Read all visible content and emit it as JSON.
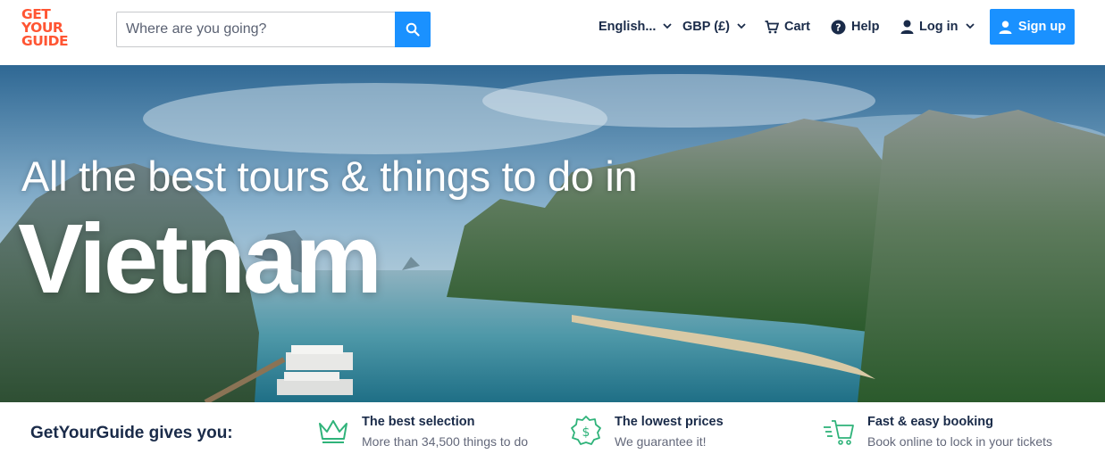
{
  "header": {
    "logo_lines": [
      "GET",
      "YOUR",
      "GUIDE"
    ],
    "search": {
      "placeholder": "Where are you going?",
      "value": ""
    },
    "nav": {
      "language": "English...",
      "currency": "GBP (£)",
      "cart": "Cart",
      "help": "Help",
      "login": "Log in"
    },
    "signup_label": "Sign up"
  },
  "hero": {
    "line1": "All the best tours & things to do in",
    "line2": "Vietnam"
  },
  "usp": {
    "title": "GetYourGuide gives you:",
    "items": [
      {
        "icon": "crown-icon",
        "heading": "The best selection",
        "sub": "More than 34,500 things to do"
      },
      {
        "icon": "price-badge-icon",
        "heading": "The lowest prices",
        "sub": "We guarantee it!"
      },
      {
        "icon": "fast-cart-icon",
        "heading": "Fast & easy booking",
        "sub": "Book online to lock in your tickets"
      }
    ]
  },
  "colors": {
    "brand_orange": "#ff5533",
    "accent_blue": "#1a91ff",
    "text_navy": "#1a2b49",
    "icon_green": "#2fb37a"
  }
}
